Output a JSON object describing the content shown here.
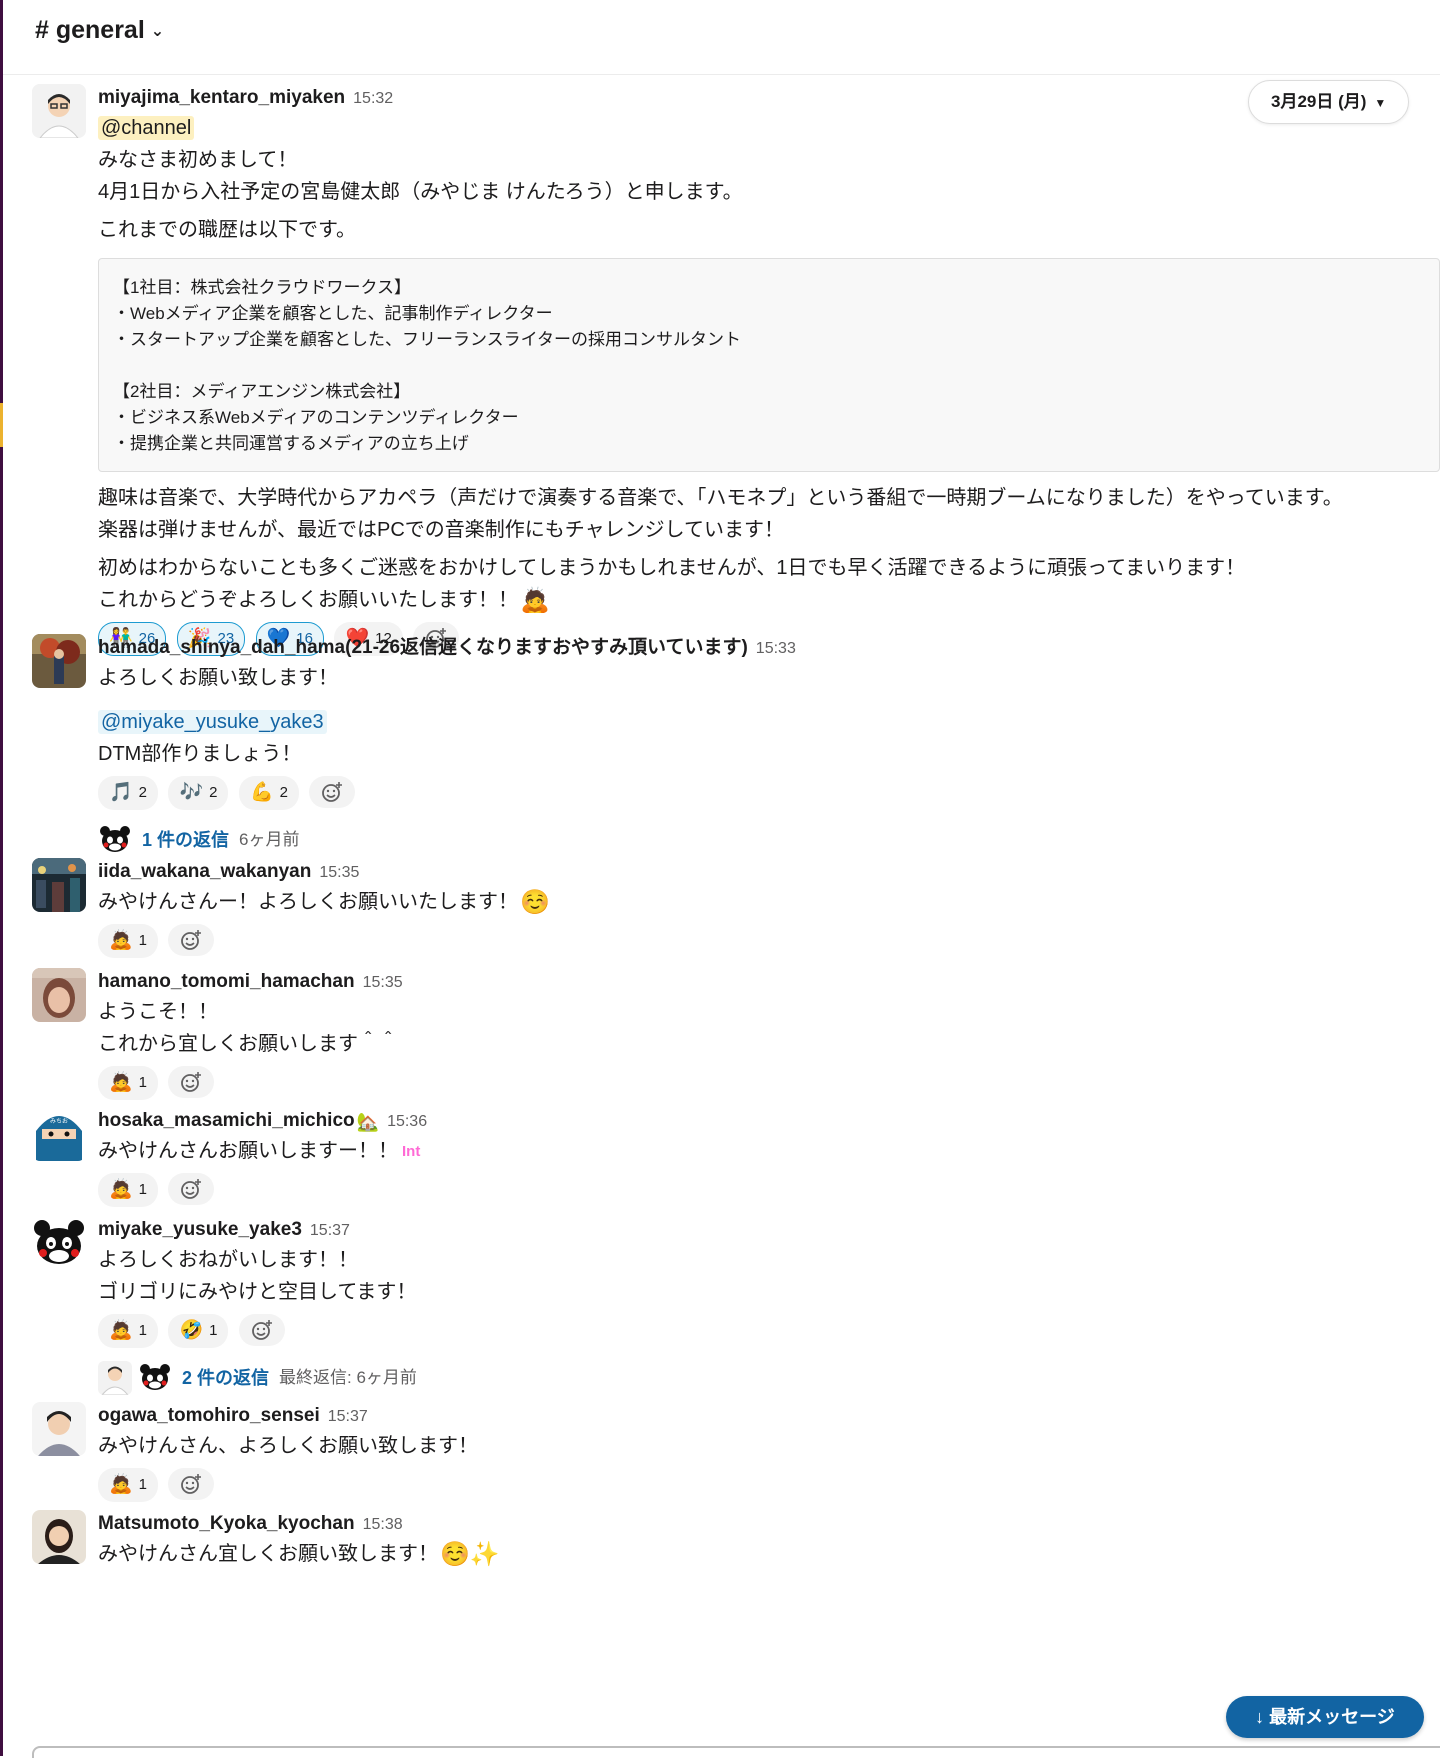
{
  "header": {
    "channel": "# general"
  },
  "date_divider": "3月29日 (月)",
  "messages": [
    {
      "user": "miyajima_kentaro_miyaken",
      "time": "15:32",
      "mention": "@channel",
      "intro": [
        "みなさま初めまして！",
        "4月1日から入社予定の宮島健太郎（みやじま けんたろう）と申します。"
      ],
      "history_intro": "これまでの職歴は以下です。",
      "code_block": [
        "【1社目：株式会社クラウドワークス】",
        "・Webメディア企業を顧客とした、記事制作ディレクター",
        "・スタートアップ企業を顧客とした、フリーランスライターの採用コンサルタント",
        "",
        "【2社目：メディアエンジン株式会社】",
        "・ビジネス系Webメディアのコンテンツディレクター",
        "・提携企業と共同運営するメディアの立ち上げ"
      ],
      "hobby": [
        "趣味は音楽で、大学時代からアカペラ（声だけで演奏する音楽で、「ハモネプ」という番組で一時期ブームになりました）をやっています。",
        "楽器は弾けませんが、最近ではPCでの音楽制作にもチャレンジしています！"
      ],
      "closing": [
        "初めはわからないことも多くご迷惑をおかけしてしまうかもしれませんが、1日でも早く活躍できるように頑張ってまいります！",
        "これからどうぞよろしくお願いいたします！！"
      ],
      "closing_emoji": "🙇",
      "reactions": [
        {
          "emoji": "👫",
          "count": "26"
        },
        {
          "emoji": "🎉",
          "count": "23"
        },
        {
          "emoji": "💙",
          "count": "16"
        },
        {
          "emoji": "❤️",
          "count": "12"
        }
      ]
    },
    {
      "user": "hamada_shinya_dah_hama(21-26返信遅くなりますおやすみ頂いています)",
      "time": "15:33",
      "line1": "よろしくお願い致します！",
      "mention": "@miyake_yusuke_yake3",
      "line2": "DTM部作りましょう！",
      "reactions": [
        {
          "emoji": "🎵",
          "count": "2"
        },
        {
          "emoji": "🎶",
          "count": "2"
        },
        {
          "emoji": "💪",
          "count": "2"
        }
      ],
      "thread": {
        "replies": "1 件の返信",
        "meta": "6ヶ月前"
      }
    },
    {
      "user": "iida_wakana_wakanyan",
      "time": "15:35",
      "text": "みやけんさんー！よろしくお願いいたします！",
      "emoji": "☺️",
      "reactions": [
        {
          "emoji": "🙇",
          "count": "1"
        }
      ]
    },
    {
      "user": "hamano_tomomi_hamachan",
      "time": "15:35",
      "lines": [
        "ようこそ！！",
        "これから宜しくお願いします＾＾"
      ],
      "reactions": [
        {
          "emoji": "🙇",
          "count": "1"
        }
      ]
    },
    {
      "user": "hosaka_masamichi_michico",
      "status_emoji": "🏡",
      "time": "15:36",
      "text": "みやけんさんお願いしますー！！",
      "badge": "Int",
      "reactions": [
        {
          "emoji": "🙇",
          "count": "1"
        }
      ]
    },
    {
      "user": "miyake_yusuke_yake3",
      "time": "15:37",
      "lines": [
        "よろしくおねがいします！！",
        "ゴリゴリにみやけと空目してます！"
      ],
      "reactions": [
        {
          "emoji": "🙇",
          "count": "1"
        },
        {
          "emoji": "🤣",
          "count": "1"
        }
      ],
      "thread": {
        "replies": "2 件の返信",
        "meta": "最終返信: 6ヶ月前"
      }
    },
    {
      "user": "ogawa_tomohiro_sensei",
      "time": "15:37",
      "text": "みやけんさん、よろしくお願い致します！",
      "reactions": [
        {
          "emoji": "🙇",
          "count": "1"
        }
      ]
    },
    {
      "user": "Matsumoto_Kyoka_kyochan",
      "time": "15:38",
      "text": "みやけんさん宜しくお願い致します！",
      "emoji": "☺️✨"
    }
  ],
  "jump_button": "↓ 最新メッセージ",
  "colors": {
    "link": "#1264a3",
    "sidebar": "#3f0e40",
    "mention_bg": "#fdf0c0"
  }
}
